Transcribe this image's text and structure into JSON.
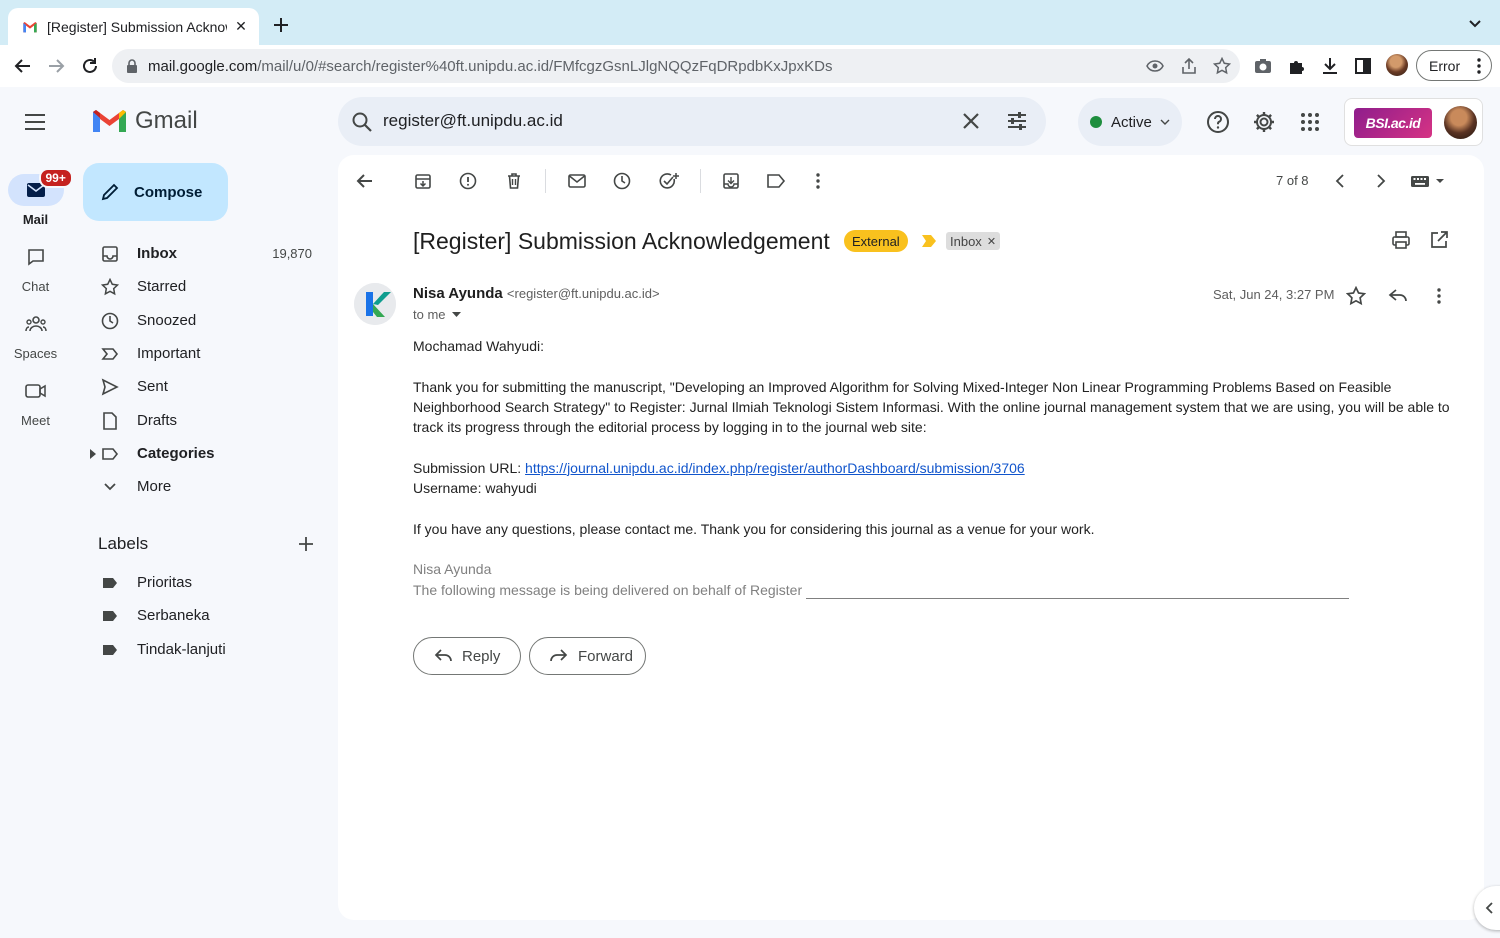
{
  "browser": {
    "tab_title": "[Register] Submission Acknowledgement",
    "tab_close": "✕",
    "url_domain": "mail.google.com",
    "url_path": "/mail/u/0/#search/register%40ft.unipdu.ac.id/FMfcgzGsnLJlgNQQzFqDRpdbKxJpxKDs",
    "error_label": "Error"
  },
  "rail": {
    "items": [
      {
        "label": "Mail",
        "badge": "99+",
        "icon": "mail-icon"
      },
      {
        "label": "Chat",
        "icon": "chat-icon"
      },
      {
        "label": "Spaces",
        "icon": "spaces-icon"
      },
      {
        "label": "Meet",
        "icon": "meet-icon"
      }
    ]
  },
  "sidebar": {
    "logo_text": "Gmail",
    "compose_label": "Compose",
    "items": [
      {
        "label": "Inbox",
        "count": "19,870",
        "icon": "inbox-icon"
      },
      {
        "label": "Starred",
        "icon": "star-icon"
      },
      {
        "label": "Snoozed",
        "icon": "clock-icon"
      },
      {
        "label": "Important",
        "icon": "important-icon"
      },
      {
        "label": "Sent",
        "icon": "send-icon"
      },
      {
        "label": "Drafts",
        "icon": "draft-icon"
      },
      {
        "label": "Categories",
        "icon": "label-icon"
      },
      {
        "label": "More",
        "icon": "chevron-down-icon"
      }
    ],
    "labels_heading": "Labels",
    "labels": [
      "Prioritas",
      "Serbaneka",
      "Tindak-lanjuti"
    ]
  },
  "search": {
    "query": "register@ft.unipdu.ac.id"
  },
  "status": {
    "label": "Active",
    "color": "#1e8e3e"
  },
  "account": {
    "org_logo_text": "BSI.ac.id"
  },
  "toolbar": {
    "pager": "7 of 8"
  },
  "message": {
    "subject": "[Register] Submission Acknowledgement",
    "external_chip": "External",
    "inbox_chip": "Inbox",
    "sender_name": "Nisa Ayunda",
    "sender_email": "<register@ft.unipdu.ac.id>",
    "to": "to me",
    "date": "Sat, Jun 24, 3:27 PM",
    "greeting": "Mochamad Wahyudi:",
    "paragraph1": "Thank you for submitting the manuscript, \"Developing an Improved Algorithm for Solving Mixed-Integer Non Linear Programming Problems Based on Feasible Neighborhood Search Strategy\" to Register: Jurnal Ilmiah Teknologi Sistem Informasi. With the online journal management system that we are using, you will be able to track its progress through the editorial process by logging in to the journal web site:",
    "submission_url_label": "Submission URL: ",
    "submission_url": "https://journal.unipdu.ac.id/index.php/register/authorDashboard/submission/3706",
    "username_line": "Username: wahyudi",
    "paragraph2": "If you have any questions, please contact me. Thank you for considering this journal as a venue for your work.",
    "signature_name": "Nisa Ayunda",
    "signature_note": "The following message is being delivered on behalf of Register"
  },
  "actions": {
    "reply": "Reply",
    "forward": "Forward"
  },
  "colors": {
    "accent_blue": "#0b57d0",
    "compose_bg": "#c2e7ff",
    "external_chip": "#f9c11e",
    "badge_red": "#c5221f"
  }
}
